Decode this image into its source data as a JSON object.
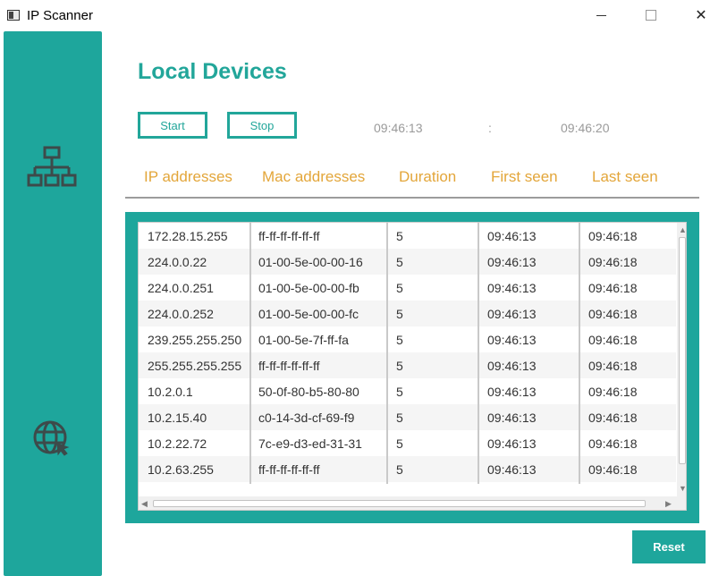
{
  "window": {
    "title": "IP Scanner"
  },
  "page": {
    "title": "Local Devices"
  },
  "controls": {
    "start_label": "Start",
    "stop_label": "Stop",
    "time_start": "09:46:13",
    "separator": ":",
    "time_end": "09:46:20",
    "reset_label": "Reset"
  },
  "table": {
    "headers": [
      "IP addresses",
      "Mac addresses",
      "Duration",
      "First seen",
      "Last seen"
    ],
    "rows": [
      [
        "172.28.15.255",
        "ff-ff-ff-ff-ff-ff",
        "5",
        "09:46:13",
        "09:46:18"
      ],
      [
        "224.0.0.22",
        "01-00-5e-00-00-16",
        "5",
        "09:46:13",
        "09:46:18"
      ],
      [
        "224.0.0.251",
        "01-00-5e-00-00-fb",
        "5",
        "09:46:13",
        "09:46:18"
      ],
      [
        "224.0.0.252",
        "01-00-5e-00-00-fc",
        "5",
        "09:46:13",
        "09:46:18"
      ],
      [
        "239.255.255.250",
        "01-00-5e-7f-ff-fa",
        "5",
        "09:46:13",
        "09:46:18"
      ],
      [
        "255.255.255.255",
        "ff-ff-ff-ff-ff-ff",
        "5",
        "09:46:13",
        "09:46:18"
      ],
      [
        "10.2.0.1",
        "50-0f-80-b5-80-80",
        "5",
        "09:46:13",
        "09:46:18"
      ],
      [
        "10.2.15.40",
        "c0-14-3d-cf-69-f9",
        "5",
        "09:46:13",
        "09:46:18"
      ],
      [
        "10.2.22.72",
        "7c-e9-d3-ed-31-31",
        "5",
        "09:46:13",
        "09:46:18"
      ],
      [
        "10.2.63.255",
        "ff-ff-ff-ff-ff-ff",
        "5",
        "09:46:13",
        "09:46:18"
      ]
    ]
  },
  "icons": {
    "sidebar": [
      "network-icon",
      "globe-icon"
    ]
  },
  "colors": {
    "accent": "#1ea69c",
    "header_text": "#e3a63a"
  }
}
